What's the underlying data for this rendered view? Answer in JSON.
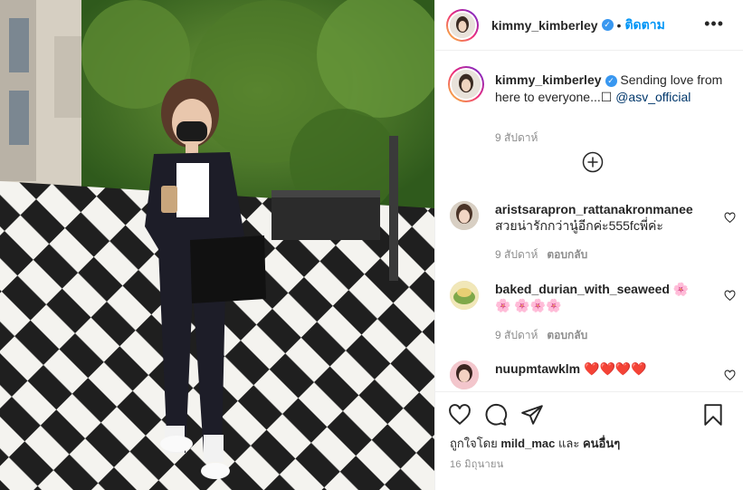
{
  "post": {
    "username": "kimmy_kimberley",
    "follow_label": "ติดตาม",
    "dot": "•",
    "more_label": "•••",
    "caption": {
      "username": "kimmy_kimberley",
      "text": "Sending love from here to everyone...",
      "glyph": "☐",
      "mention": "@asv_official",
      "time": "9 สัปดาห์"
    },
    "comments": [
      {
        "username": "aristsarapron_rattanakronmanee",
        "text": "สวยน่ารักกว่านู๋อีกค่ะ555fcพี่ค่ะ",
        "time": "9 สัปดาห์",
        "reply_label": "ตอบกลับ"
      },
      {
        "username": "baked_durian_with_seaweed",
        "text": "🌸🌸 🌸🌸🌸",
        "time": "9 สัปดาห์",
        "reply_label": "ตอบกลับ"
      },
      {
        "username": "nuupmtawklm",
        "text": "❤️❤️❤️❤️",
        "time": "",
        "reply_label": ""
      }
    ],
    "likes": {
      "prefix": "ถูกใจโดย",
      "user": "mild_mac",
      "conj": "และ",
      "others": "คนอื่นๆ"
    },
    "date": "16 มิถุนายน"
  },
  "icons": {
    "verified": "verified-badge",
    "more": "more-options-icon",
    "load_more": "plus-circle-icon",
    "like": "heart-icon",
    "comment": "comment-icon",
    "share": "paper-plane-icon",
    "save": "bookmark-icon"
  },
  "colors": {
    "accent": "#0095f6",
    "verified": "#3897f0",
    "muted": "#8e8e8e",
    "heart": "#ed4956"
  }
}
